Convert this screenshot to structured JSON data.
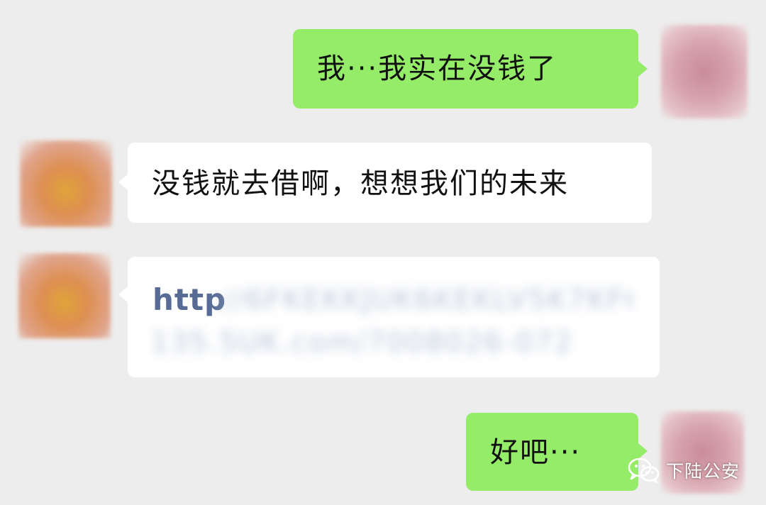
{
  "messages": [
    {
      "side": "right",
      "text": "我···我实在没钱了"
    },
    {
      "side": "left",
      "text": "没钱就去借啊，想想我们的未来"
    },
    {
      "side": "left",
      "link_prefix": "http",
      "link_rest_line1": "://6FKEKKJUK6KEKLV5K7KF6LNRQ",
      "link_rest_line2": "135.5UK.com/7008026-0723"
    },
    {
      "side": "right",
      "text": "好吧···"
    }
  ],
  "watermark": {
    "text": "下陆公安",
    "icon": "wechat-icon"
  },
  "colors": {
    "background": "#ededed",
    "outgoing_bubble": "#95ec69",
    "incoming_bubble": "#ffffff",
    "link": "#576b95"
  }
}
